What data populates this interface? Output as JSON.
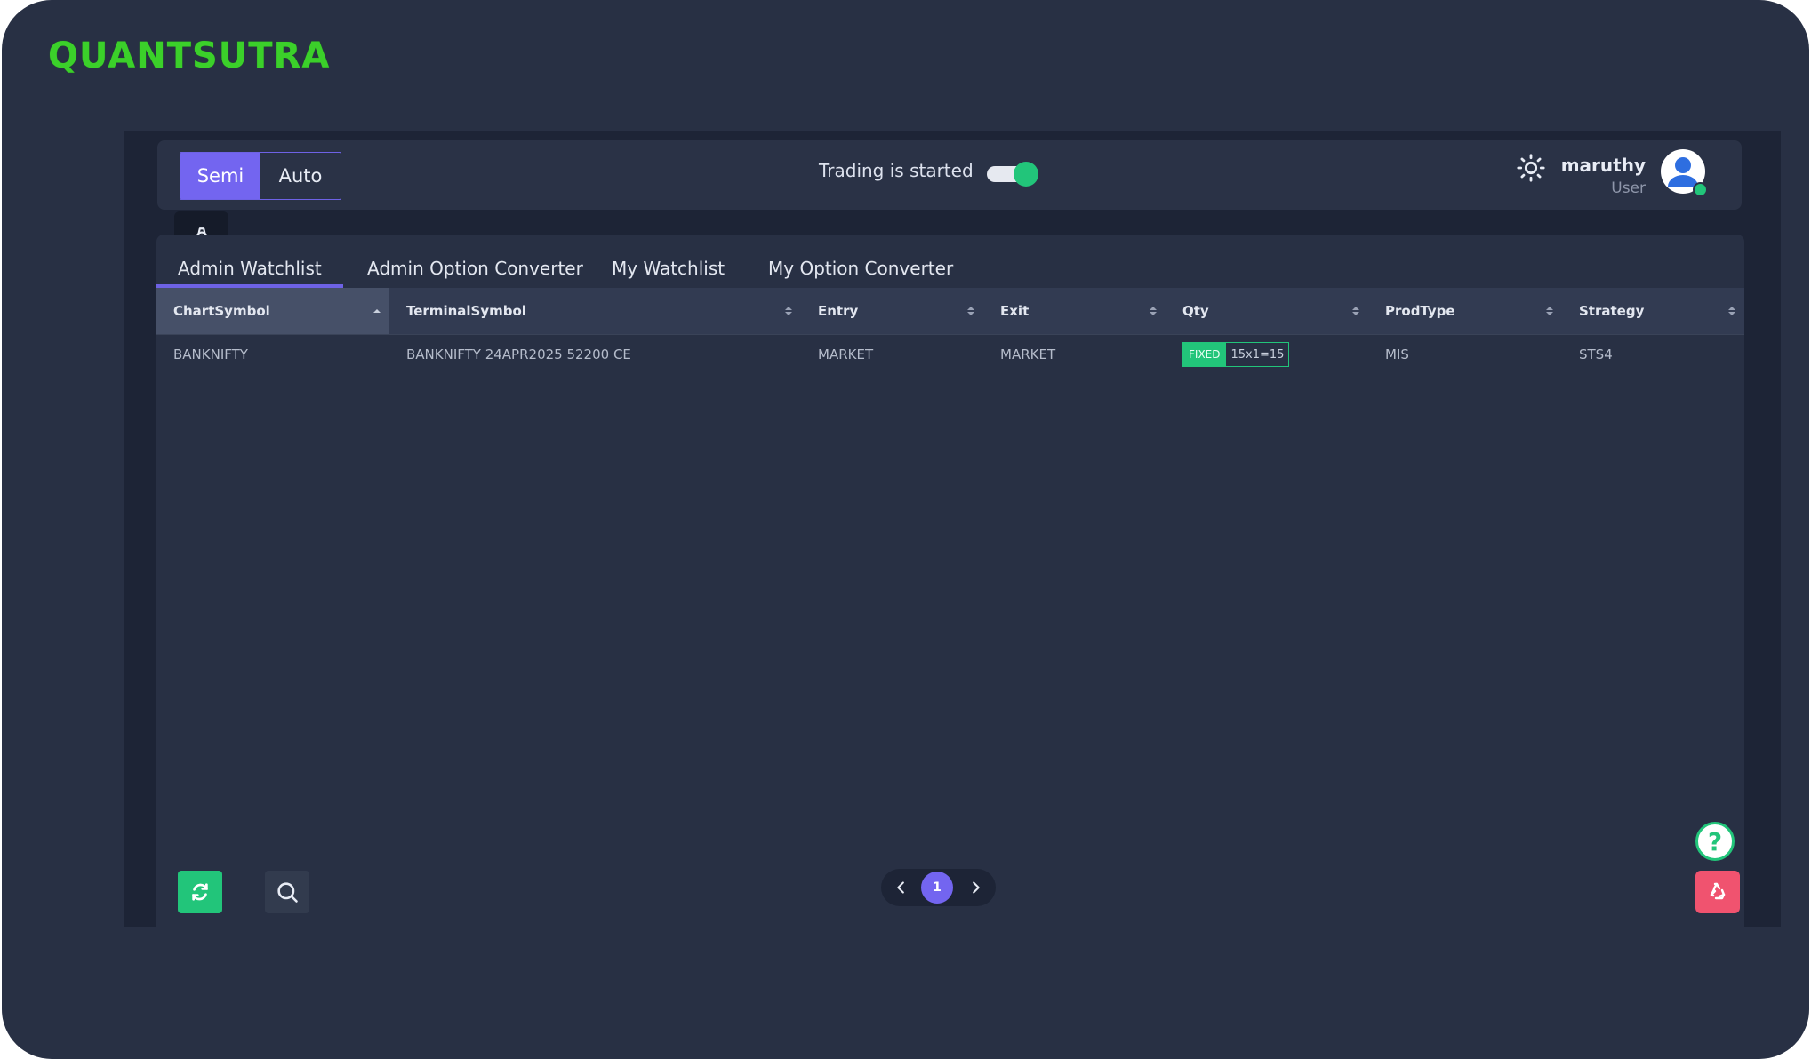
{
  "brand": {
    "logo_text": "QUANTSUTRA",
    "logo_color": "#3bd02a"
  },
  "colors": {
    "accent": "#7365f0",
    "success": "#22c57a",
    "danger": "#f0536f",
    "bg": "#283044"
  },
  "sidebar": {
    "items": [
      {
        "icon": "watch-icon",
        "active": true
      },
      {
        "icon": "cart-icon"
      },
      {
        "icon": "shopping-bag-icon"
      },
      {
        "icon": "trending-up-icon"
      },
      {
        "icon": "gear-icon"
      },
      {
        "icon": "document-icon"
      },
      {
        "icon": "book-icon"
      },
      {
        "icon": "gear-icon"
      },
      {
        "icon": "trending-up-icon"
      },
      {
        "icon": "chat-icon"
      },
      {
        "icon": "help-circle-icon"
      }
    ]
  },
  "topbar": {
    "modes": [
      "Semi",
      "Auto"
    ],
    "active_mode": "Semi",
    "trading_status": "Trading is started",
    "trading_on": true,
    "user": {
      "name": "maruthy",
      "role": "User"
    }
  },
  "tabs": [
    {
      "label": "Admin Watchlist",
      "active": true
    },
    {
      "label": "Admin Option Converter"
    },
    {
      "label": "My Watchlist"
    },
    {
      "label": "My Option Converter"
    }
  ],
  "table": {
    "columns": [
      "ChartSymbol",
      "TerminalSymbol",
      "Entry",
      "Exit",
      "Qty",
      "ProdType",
      "Strategy"
    ],
    "sorted_column": "ChartSymbol",
    "rows": [
      {
        "ChartSymbol": "BANKNIFTY",
        "TerminalSymbol": "BANKNIFTY 24APR2025 52200 CE",
        "Entry": "MARKET",
        "Exit": "MARKET",
        "QtyType": "FIXED",
        "QtyValue": "15x1=15",
        "ProdType": "MIS",
        "Strategy": "STS4"
      }
    ]
  },
  "pagination": {
    "current_page": "1"
  },
  "help": {
    "symbol": "?"
  }
}
